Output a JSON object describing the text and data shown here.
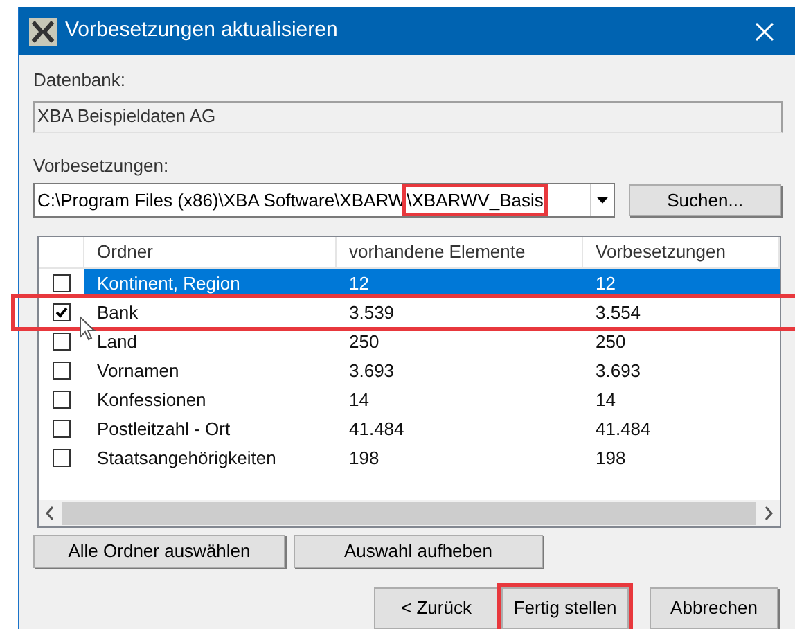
{
  "window": {
    "title": "Vorbesetzungen aktualisieren"
  },
  "database": {
    "label": "Datenbank:",
    "value": "XBA Beispieldaten AG"
  },
  "presets": {
    "label": "Vorbesetzungen:",
    "path": [
      {
        "text": "C:\\Program Files (x86)\\XBA Software\\XBARW",
        "highlighted": false
      },
      {
        "text": "\\XBARWV_Basis",
        "highlighted": true
      }
    ],
    "browse_button": "Suchen..."
  },
  "table": {
    "columns": [
      "Ordner",
      "vorhandene Elemente",
      "Vorbesetzungen"
    ],
    "rows": [
      {
        "checked": false,
        "selected": true,
        "highlighted": false,
        "cells": [
          "Kontinent, Region",
          "12",
          "12"
        ]
      },
      {
        "checked": true,
        "selected": false,
        "highlighted": true,
        "cells": [
          "Bank",
          "3.539",
          "3.554"
        ]
      },
      {
        "checked": false,
        "selected": false,
        "highlighted": false,
        "cells": [
          "Land",
          "250",
          "250"
        ]
      },
      {
        "checked": false,
        "selected": false,
        "highlighted": false,
        "cells": [
          "Vornamen",
          "3.693",
          "3.693"
        ]
      },
      {
        "checked": false,
        "selected": false,
        "highlighted": false,
        "cells": [
          "Konfessionen",
          "14",
          "14"
        ]
      },
      {
        "checked": false,
        "selected": false,
        "highlighted": false,
        "cells": [
          "Postleitzahl - Ort",
          "41.484",
          "41.484"
        ]
      },
      {
        "checked": false,
        "selected": false,
        "highlighted": false,
        "cells": [
          "Staatsangehörigkeiten",
          "198",
          "198"
        ]
      }
    ]
  },
  "selection_buttons": [
    "Alle Ordner auswählen",
    "Auswahl aufheben"
  ],
  "footer_buttons": [
    {
      "label": "< Zurück",
      "highlighted": false
    },
    {
      "label": "Fertig stellen",
      "highlighted": true
    },
    {
      "label": "Abbrechen",
      "highlighted": false
    }
  ]
}
